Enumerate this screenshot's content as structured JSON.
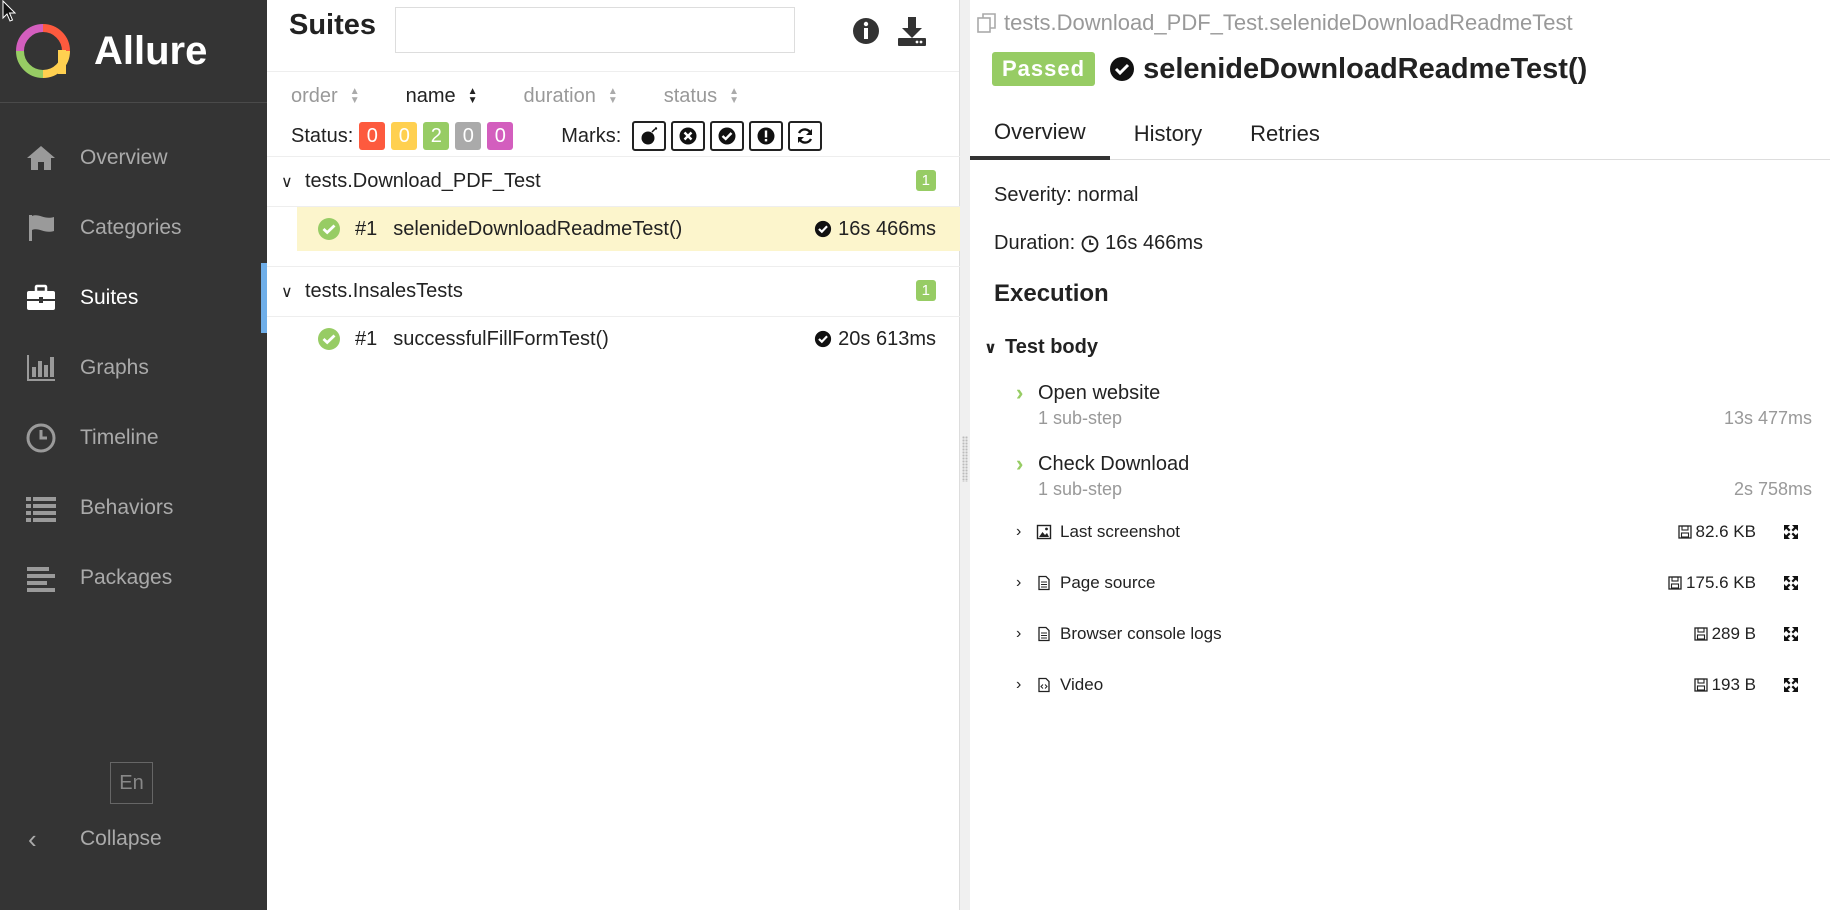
{
  "app": {
    "name": "Allure"
  },
  "sidebar": {
    "items": [
      {
        "label": "Overview",
        "icon": "home-icon"
      },
      {
        "label": "Categories",
        "icon": "flag-icon"
      },
      {
        "label": "Suites",
        "icon": "briefcase-icon",
        "active": true
      },
      {
        "label": "Graphs",
        "icon": "bar-chart-icon"
      },
      {
        "label": "Timeline",
        "icon": "clock-icon"
      },
      {
        "label": "Behaviors",
        "icon": "list-icon"
      },
      {
        "label": "Packages",
        "icon": "align-left-icon"
      }
    ],
    "language": "En",
    "collapse_label": "Collapse"
  },
  "suites": {
    "title": "Suites",
    "search_value": "",
    "sort": [
      {
        "label": "order"
      },
      {
        "label": "name",
        "active": true
      },
      {
        "label": "duration"
      },
      {
        "label": "status"
      }
    ],
    "status_label": "Status:",
    "status_counts": [
      {
        "value": "0",
        "color": "#fd5a3e"
      },
      {
        "value": "0",
        "color": "#ffd050"
      },
      {
        "value": "2",
        "color": "#97cc64"
      },
      {
        "value": "0",
        "color": "#aaaaaa"
      },
      {
        "value": "0",
        "color": "#d35ebe"
      }
    ],
    "marks_label": "Marks:",
    "groups": [
      {
        "name": "tests.Download_PDF_Test",
        "count": "1",
        "tests": [
          {
            "num": "#1",
            "name": "selenideDownloadReadmeTest()",
            "duration": "16s 466ms",
            "selected": true
          }
        ]
      },
      {
        "name": "tests.InsalesTests",
        "count": "1",
        "tests": [
          {
            "num": "#1",
            "name": "successfulFillFormTest()",
            "duration": "20s 613ms",
            "selected": false
          }
        ]
      }
    ]
  },
  "detail": {
    "breadcrumb": "tests.Download_PDF_Test.selenideDownloadReadmeTest",
    "status_badge": "Passed",
    "title": "selenideDownloadReadmeTest()",
    "tabs": [
      "Overview",
      "History",
      "Retries"
    ],
    "severity": "Severity: normal",
    "duration_label": "Duration:",
    "duration_value": "16s 466ms",
    "execution_title": "Execution",
    "test_body_label": "Test body",
    "steps": [
      {
        "name": "Open website",
        "sub": "1 sub-step",
        "time": "13s 477ms"
      },
      {
        "name": "Check Download",
        "sub": "1 sub-step",
        "time": "2s 758ms"
      }
    ],
    "attachments": [
      {
        "name": "Last screenshot",
        "size": "82.6 KB",
        "icon": "image-icon"
      },
      {
        "name": "Page source",
        "size": "175.6 KB",
        "icon": "file-icon"
      },
      {
        "name": "Browser console logs",
        "size": "289 B",
        "icon": "file-icon"
      },
      {
        "name": "Video",
        "size": "193 B",
        "icon": "code-file-icon"
      }
    ]
  }
}
